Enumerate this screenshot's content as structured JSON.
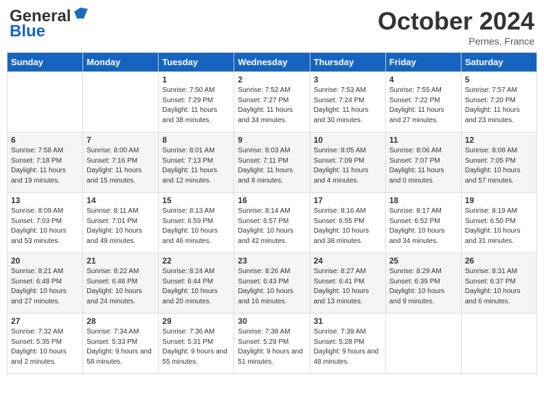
{
  "header": {
    "logo_line1": "General",
    "logo_line2": "Blue",
    "month": "October 2024",
    "location": "Pernes, France"
  },
  "weekdays": [
    "Sunday",
    "Monday",
    "Tuesday",
    "Wednesday",
    "Thursday",
    "Friday",
    "Saturday"
  ],
  "weeks": [
    [
      {
        "day": "",
        "info": ""
      },
      {
        "day": "",
        "info": ""
      },
      {
        "day": "1",
        "info": "Sunrise: 7:50 AM\nSunset: 7:29 PM\nDaylight: 11 hours and 38 minutes."
      },
      {
        "day": "2",
        "info": "Sunrise: 7:52 AM\nSunset: 7:27 PM\nDaylight: 11 hours and 34 minutes."
      },
      {
        "day": "3",
        "info": "Sunrise: 7:53 AM\nSunset: 7:24 PM\nDaylight: 11 hours and 30 minutes."
      },
      {
        "day": "4",
        "info": "Sunrise: 7:55 AM\nSunset: 7:22 PM\nDaylight: 11 hours and 27 minutes."
      },
      {
        "day": "5",
        "info": "Sunrise: 7:57 AM\nSunset: 7:20 PM\nDaylight: 11 hours and 23 minutes."
      }
    ],
    [
      {
        "day": "6",
        "info": "Sunrise: 7:58 AM\nSunset: 7:18 PM\nDaylight: 11 hours and 19 minutes."
      },
      {
        "day": "7",
        "info": "Sunrise: 8:00 AM\nSunset: 7:16 PM\nDaylight: 11 hours and 15 minutes."
      },
      {
        "day": "8",
        "info": "Sunrise: 8:01 AM\nSunset: 7:13 PM\nDaylight: 11 hours and 12 minutes."
      },
      {
        "day": "9",
        "info": "Sunrise: 8:03 AM\nSunset: 7:11 PM\nDaylight: 11 hours and 8 minutes."
      },
      {
        "day": "10",
        "info": "Sunrise: 8:05 AM\nSunset: 7:09 PM\nDaylight: 11 hours and 4 minutes."
      },
      {
        "day": "11",
        "info": "Sunrise: 8:06 AM\nSunset: 7:07 PM\nDaylight: 11 hours and 0 minutes."
      },
      {
        "day": "12",
        "info": "Sunrise: 8:08 AM\nSunset: 7:05 PM\nDaylight: 10 hours and 57 minutes."
      }
    ],
    [
      {
        "day": "13",
        "info": "Sunrise: 8:09 AM\nSunset: 7:03 PM\nDaylight: 10 hours and 53 minutes."
      },
      {
        "day": "14",
        "info": "Sunrise: 8:11 AM\nSunset: 7:01 PM\nDaylight: 10 hours and 49 minutes."
      },
      {
        "day": "15",
        "info": "Sunrise: 8:13 AM\nSunset: 6:59 PM\nDaylight: 10 hours and 46 minutes."
      },
      {
        "day": "16",
        "info": "Sunrise: 8:14 AM\nSunset: 6:57 PM\nDaylight: 10 hours and 42 minutes."
      },
      {
        "day": "17",
        "info": "Sunrise: 8:16 AM\nSunset: 6:55 PM\nDaylight: 10 hours and 38 minutes."
      },
      {
        "day": "18",
        "info": "Sunrise: 8:17 AM\nSunset: 6:52 PM\nDaylight: 10 hours and 34 minutes."
      },
      {
        "day": "19",
        "info": "Sunrise: 8:19 AM\nSunset: 6:50 PM\nDaylight: 10 hours and 31 minutes."
      }
    ],
    [
      {
        "day": "20",
        "info": "Sunrise: 8:21 AM\nSunset: 6:48 PM\nDaylight: 10 hours and 27 minutes."
      },
      {
        "day": "21",
        "info": "Sunrise: 8:22 AM\nSunset: 6:46 PM\nDaylight: 10 hours and 24 minutes."
      },
      {
        "day": "22",
        "info": "Sunrise: 8:24 AM\nSunset: 6:44 PM\nDaylight: 10 hours and 20 minutes."
      },
      {
        "day": "23",
        "info": "Sunrise: 8:26 AM\nSunset: 6:43 PM\nDaylight: 10 hours and 16 minutes."
      },
      {
        "day": "24",
        "info": "Sunrise: 8:27 AM\nSunset: 6:41 PM\nDaylight: 10 hours and 13 minutes."
      },
      {
        "day": "25",
        "info": "Sunrise: 8:29 AM\nSunset: 6:39 PM\nDaylight: 10 hours and 9 minutes."
      },
      {
        "day": "26",
        "info": "Sunrise: 8:31 AM\nSunset: 6:37 PM\nDaylight: 10 hours and 6 minutes."
      }
    ],
    [
      {
        "day": "27",
        "info": "Sunrise: 7:32 AM\nSunset: 5:35 PM\nDaylight: 10 hours and 2 minutes."
      },
      {
        "day": "28",
        "info": "Sunrise: 7:34 AM\nSunset: 5:33 PM\nDaylight: 9 hours and 58 minutes."
      },
      {
        "day": "29",
        "info": "Sunrise: 7:36 AM\nSunset: 5:31 PM\nDaylight: 9 hours and 55 minutes."
      },
      {
        "day": "30",
        "info": "Sunrise: 7:38 AM\nSunset: 5:29 PM\nDaylight: 9 hours and 51 minutes."
      },
      {
        "day": "31",
        "info": "Sunrise: 7:39 AM\nSunset: 5:28 PM\nDaylight: 9 hours and 48 minutes."
      },
      {
        "day": "",
        "info": ""
      },
      {
        "day": "",
        "info": ""
      }
    ]
  ]
}
